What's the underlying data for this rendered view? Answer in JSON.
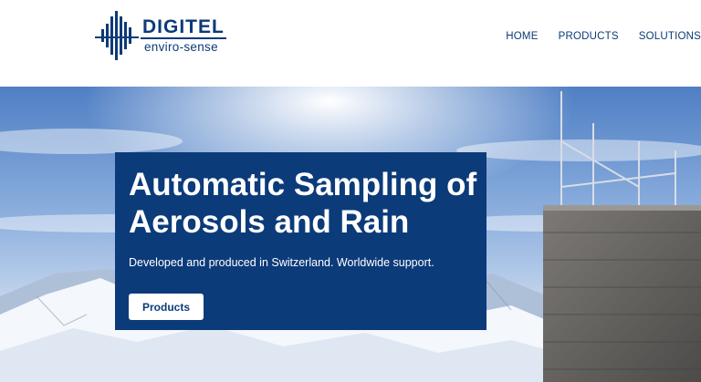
{
  "header": {
    "logo": {
      "title": "DIGITEL",
      "subtitle": "enviro-sense"
    },
    "nav": [
      {
        "label": "HOME"
      },
      {
        "label": "PRODUCTS"
      },
      {
        "label": "SOLUTIONS"
      }
    ]
  },
  "hero": {
    "title": "Automatic Sampling of Aerosols and Rain",
    "subtitle": "Developed and produced in Switzerland. Worldwide support.",
    "button_label": "Products",
    "colors": {
      "panel": "#0c3b7a",
      "brand": "#0b3a78"
    }
  }
}
